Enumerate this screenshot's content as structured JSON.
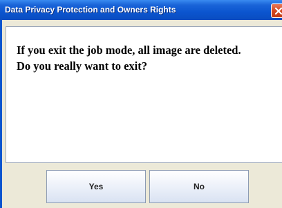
{
  "window": {
    "title": "Data Privacy Protection and Owners Rights"
  },
  "message": {
    "line1": "If you exit the job mode, all image are deleted.",
    "line2": "Do you really want to exit?"
  },
  "buttons": {
    "yes_label": "Yes",
    "no_label": "No"
  },
  "icons": {
    "close": "close-icon"
  },
  "colors": {
    "titlebar": "#0b55cf",
    "close_button": "#d4481f",
    "panel_background": "#ffffff",
    "dialog_background": "#ece9d8"
  }
}
